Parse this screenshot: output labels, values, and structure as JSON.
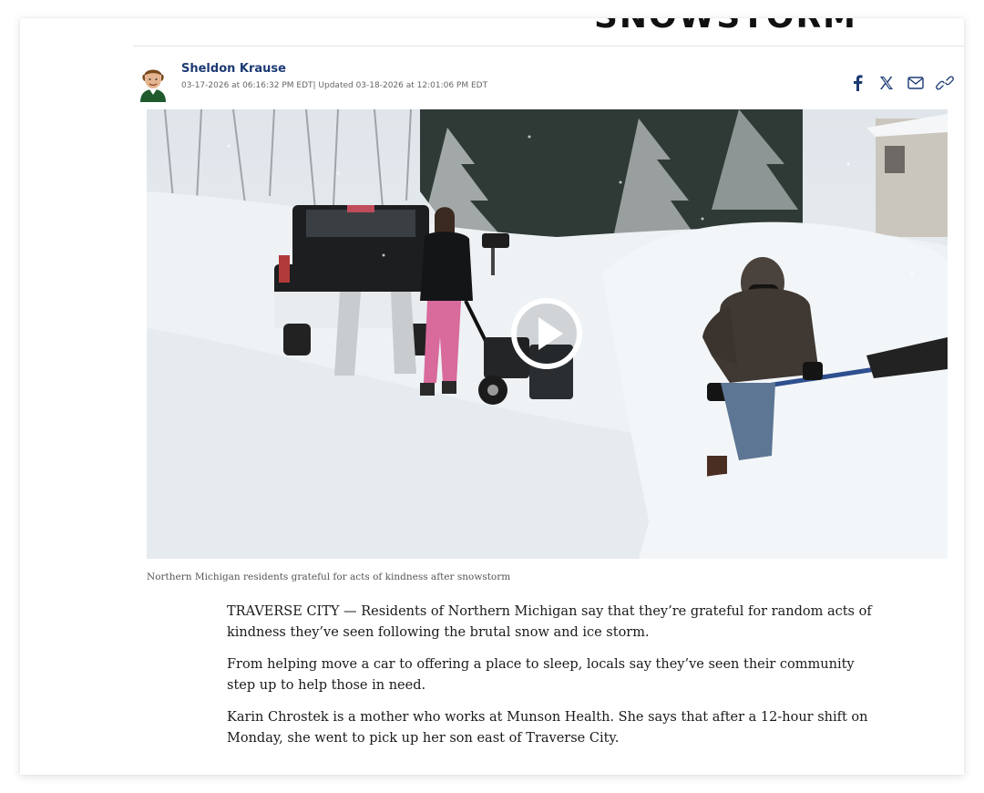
{
  "article": {
    "headline_fragment": "SNOWSTORM",
    "author": {
      "name": "Sheldon Krause",
      "timestamp": "03-17-2026 at 06:16:32 PM EDT| Updated 03-18-2026 at 12:01:06 PM EDT"
    },
    "share_buttons": [
      {
        "icon": "facebook-icon",
        "color": "#1b3a73"
      },
      {
        "icon": "x-icon",
        "color": "#1b3a73"
      },
      {
        "icon": "mail-icon",
        "color": "#1b3a73"
      },
      {
        "icon": "link-icon",
        "color": "#1b3a73"
      }
    ],
    "video": {
      "icon": "play-icon",
      "caption": "Northern Michigan residents grateful for acts of kindness after snowstorm"
    },
    "paragraphs": [
      "TRAVERSE CITY — Residents of Northern Michigan say that they’re grateful for random acts of kindness they’ve seen following the brutal snow and ice storm.",
      "From helping move a car to offering a place to sleep, locals say they’ve seen their community step up to help those in need.",
      "Karin Chrostek is a mother who works at Munson Health. She says that after a 12-hour shift on Monday, she went to pick up her son east of Traverse City."
    ]
  },
  "colors": {
    "accent": "#1b3a73",
    "snow": "#eef2f5"
  }
}
